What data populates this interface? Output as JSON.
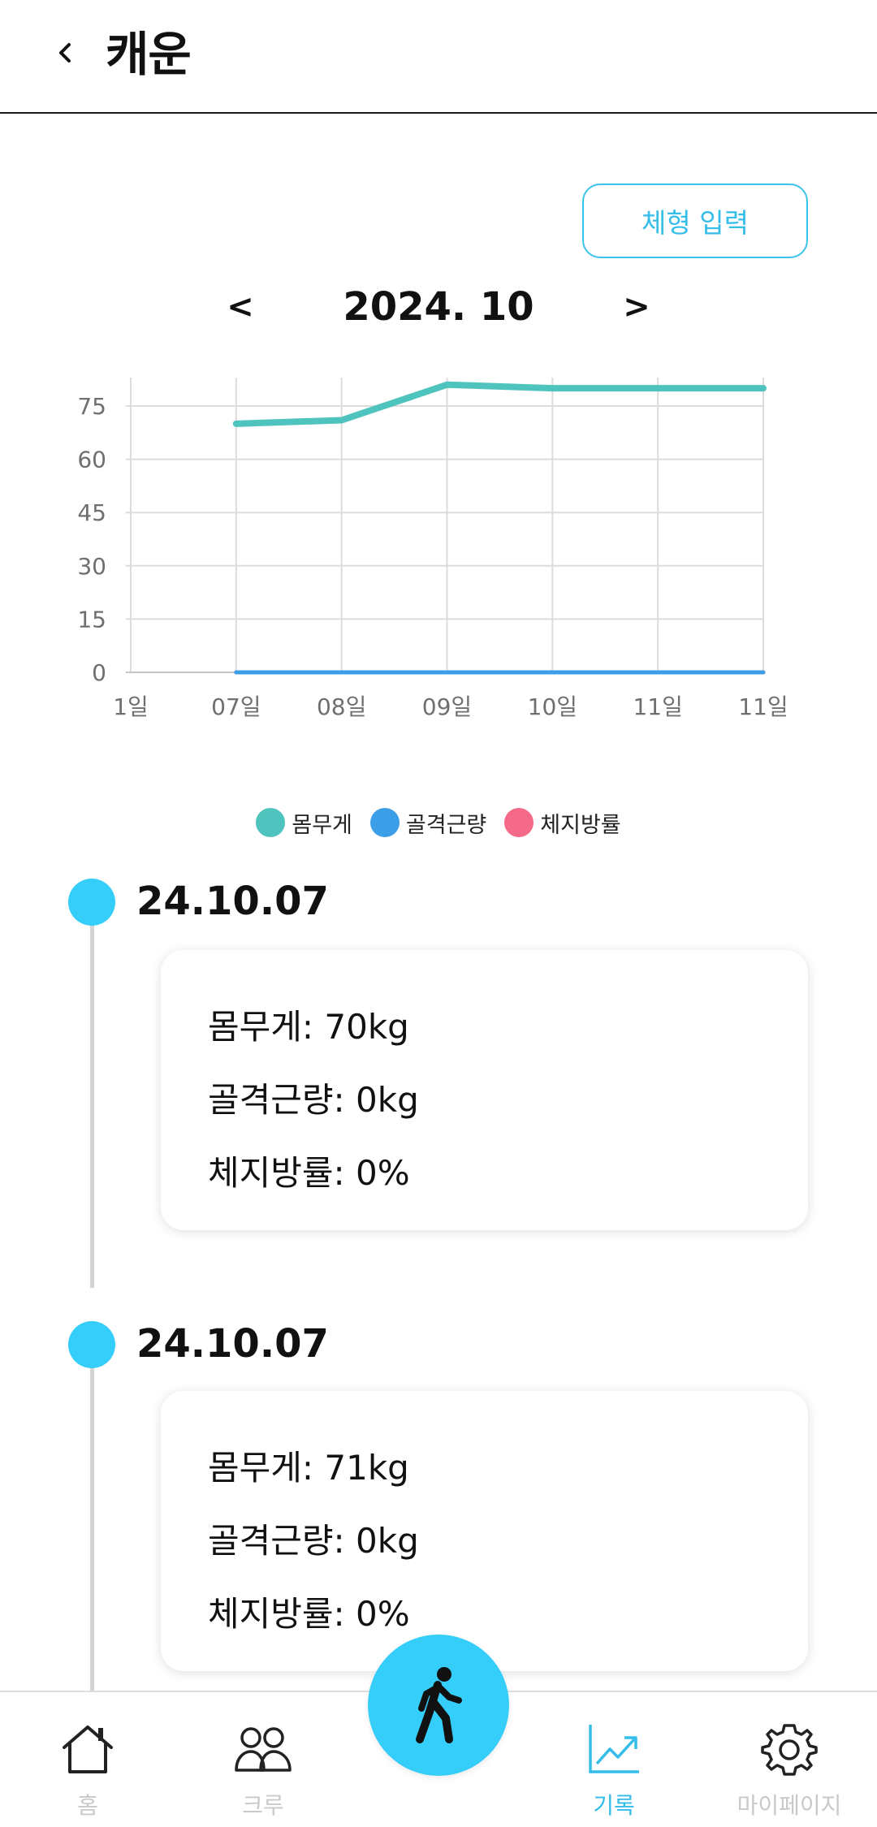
{
  "header": {
    "title": "캐운",
    "back_icon": "chevron-left-icon"
  },
  "actions": {
    "body_input_label": "체형 입력"
  },
  "month_nav": {
    "prev": "<",
    "label": "2024. 10",
    "next": ">"
  },
  "colors": {
    "accent": "#35cdf9",
    "weight": "#4fc3bd",
    "muscle": "#3d9ee8",
    "fat": "#f56a88",
    "grid": "#dcdcdc",
    "tick": "#6f6f6f",
    "nav_inactive": "#c9c9c9"
  },
  "chart_data": {
    "type": "line",
    "x": [
      "1일",
      "07일",
      "08일",
      "09일",
      "10일",
      "11일",
      "11일"
    ],
    "series": [
      {
        "name": "몸무게",
        "values": [
          null,
          70,
          71,
          81,
          80,
          80,
          80
        ]
      },
      {
        "name": "골격근량",
        "values": [
          null,
          0,
          0,
          0,
          0,
          0,
          0
        ]
      },
      {
        "name": "체지방률",
        "values": [
          null,
          0,
          0,
          0,
          0,
          0,
          0
        ]
      }
    ],
    "yticks": [
      0,
      15,
      30,
      45,
      60,
      75
    ],
    "ylim": [
      0,
      83
    ],
    "grid": true,
    "legend": "bottom-center"
  },
  "legend": [
    {
      "label": "몸무게",
      "color": "#4fc3bd"
    },
    {
      "label": "골격근량",
      "color": "#3d9ee8"
    },
    {
      "label": "체지방률",
      "color": "#f56a88"
    }
  ],
  "entries": [
    {
      "date": "24.10.07",
      "weight": "몸무게: 70kg",
      "muscle": "골격근량: 0kg",
      "fat": "체지방률: 0%"
    },
    {
      "date": "24.10.07",
      "weight": "몸무게: 71kg",
      "muscle": "골격근량: 0kg",
      "fat": "체지방률: 0%"
    }
  ],
  "fab": {
    "icon": "walking-person-icon"
  },
  "nav": [
    {
      "label": "홈",
      "icon": "home-icon",
      "active": false
    },
    {
      "label": "크루",
      "icon": "users-icon",
      "active": false
    },
    {
      "label": "기록",
      "icon": "trend-chart-icon",
      "active": true
    },
    {
      "label": "마이페이지",
      "icon": "gear-icon",
      "active": false
    }
  ]
}
